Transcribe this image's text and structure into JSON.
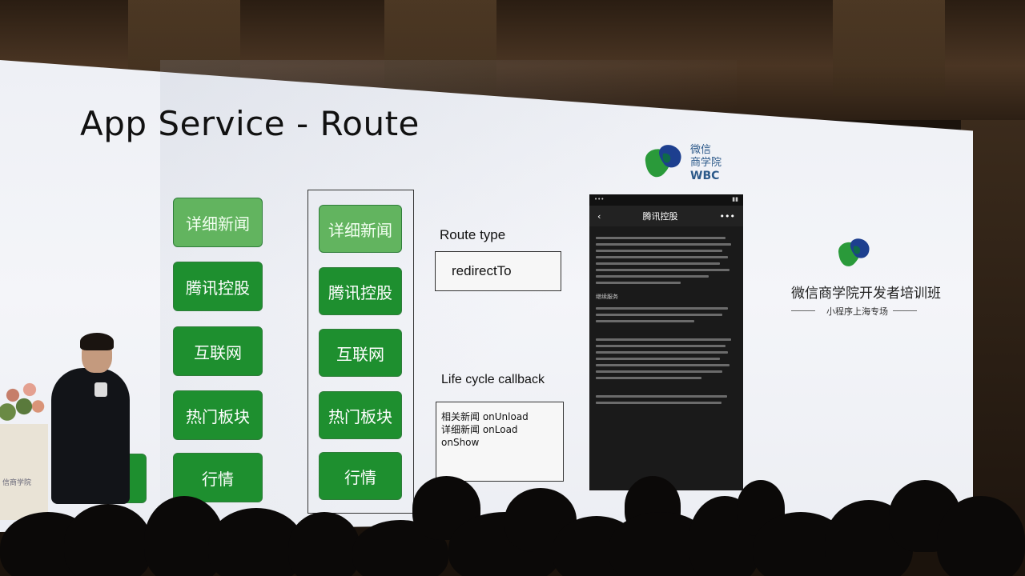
{
  "slide": {
    "title": "App Service - Route",
    "left_column": [
      "详细新闻",
      "腾讯控股",
      "互联网",
      "热门板块",
      "行情"
    ],
    "right_column": [
      "详细新闻",
      "腾讯控股",
      "互联网",
      "热门板块",
      "行情"
    ],
    "route_type_label": "Route type",
    "route_type_value": "redirectTo",
    "lifecycle_label": "Life cycle callback",
    "lifecycle_lines": [
      "相关新闻 onUnload",
      "详细新闻 onLoad onShow"
    ],
    "logo": {
      "line1": "微信",
      "line2": "商学院",
      "line3": "WBC"
    },
    "phone": {
      "nav_title": "腾讯控股",
      "section_heading": "继续服务"
    },
    "right_panel": {
      "title": "微信商学院开发者培训班",
      "subtitle": "小程序上海专场"
    }
  },
  "venue": {
    "podium_text": "信商学院"
  },
  "colors": {
    "button_active": "#62b45f",
    "button_normal": "#1e8f2f",
    "logo_green": "#2a9a3a",
    "logo_blue": "#1d3f8f"
  }
}
